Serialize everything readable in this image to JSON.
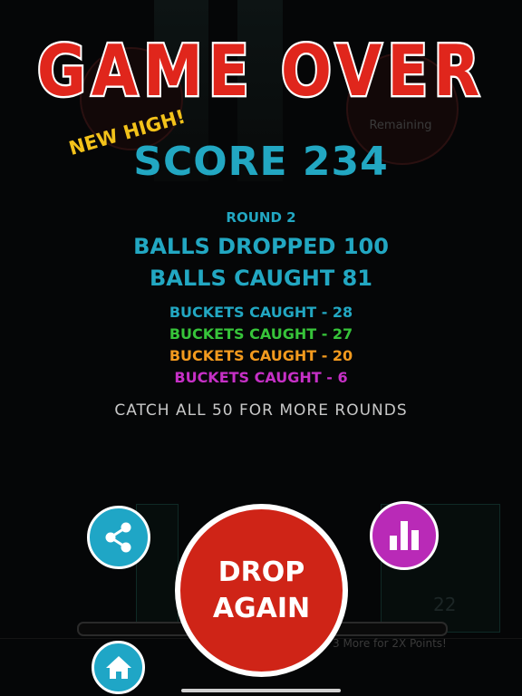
{
  "title": "GAME OVER",
  "badge": "NEW HIGH!",
  "score_line": "SCORE 234",
  "round": "ROUND 2",
  "balls_dropped": "BALLS DROPPED 100",
  "balls_caught": "BALLS CAUGHT 81",
  "buckets": [
    {
      "label": "BUCKETS CAUGHT - 28",
      "color": "#22a7c2"
    },
    {
      "label": "BUCKETS CAUGHT - 27",
      "color": "#37c43a"
    },
    {
      "label": "BUCKETS CAUGHT - 20",
      "color": "#f29a1e"
    },
    {
      "label": "BUCKETS CAUGHT - 6",
      "color": "#c630c6"
    }
  ],
  "hint": "CATCH ALL 50 FOR MORE ROUNDS",
  "buttons": {
    "drop_again": "DROP\nAGAIN",
    "share_icon": "share-icon",
    "stats_icon": "bar-chart-icon",
    "home_icon": "home-icon"
  },
  "background": {
    "remaining_label": "Remaining",
    "bonus_text": "3 More for 2X Points!",
    "counter": "22"
  },
  "colors": {
    "title_red": "#e0261c",
    "accent_blue": "#22a7c2",
    "badge_yellow": "#f3c21a",
    "stats_purple": "#b92ab7",
    "drop_red": "#cf2417"
  }
}
